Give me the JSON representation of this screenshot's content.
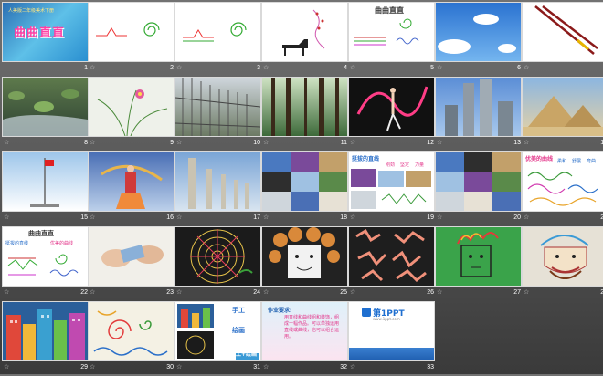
{
  "slides": [
    {
      "num": "1",
      "title": "曲曲直直",
      "subtitle": "人美版二年级美术下册"
    },
    {
      "num": "2"
    },
    {
      "num": "3"
    },
    {
      "num": "4"
    },
    {
      "num": "5",
      "title": "曲曲直直"
    },
    {
      "num": "6"
    },
    {
      "num": "7"
    },
    {
      "num": "8"
    },
    {
      "num": "9"
    },
    {
      "num": "10"
    },
    {
      "num": "11"
    },
    {
      "num": "12"
    },
    {
      "num": "13"
    },
    {
      "num": "14"
    },
    {
      "num": "15"
    },
    {
      "num": "16"
    },
    {
      "num": "17"
    },
    {
      "num": "18"
    },
    {
      "num": "19",
      "title": "挺拔的直线",
      "labels": [
        "刚劲",
        "坚定",
        "力量"
      ]
    },
    {
      "num": "20"
    },
    {
      "num": "21",
      "title": "优美的曲线",
      "labels": [
        "柔和",
        "舒展",
        "弯曲"
      ]
    },
    {
      "num": "22",
      "title": "曲曲直直",
      "left_label": "挺拔的直线",
      "right_label": "优美的曲线"
    },
    {
      "num": "23"
    },
    {
      "num": "24"
    },
    {
      "num": "25"
    },
    {
      "num": "26"
    },
    {
      "num": "27"
    },
    {
      "num": "28"
    },
    {
      "num": "29"
    },
    {
      "num": "30"
    },
    {
      "num": "31",
      "labels": [
        "手工",
        "绘画",
        "手工+绘画"
      ]
    },
    {
      "num": "32",
      "heading": "作业要求:",
      "body": "用直线和曲线组和装饰，组成一幅作品。可以单独运用直线或曲线，也可以组合运用。"
    },
    {
      "num": "33",
      "logo": "第1PPT",
      "url": "www.1ppt.com"
    }
  ],
  "colors": {
    "background_top": "#727272",
    "background_bottom": "#3a3a3a",
    "slide_border": "#d9d9d9",
    "number": "#ffffff"
  }
}
